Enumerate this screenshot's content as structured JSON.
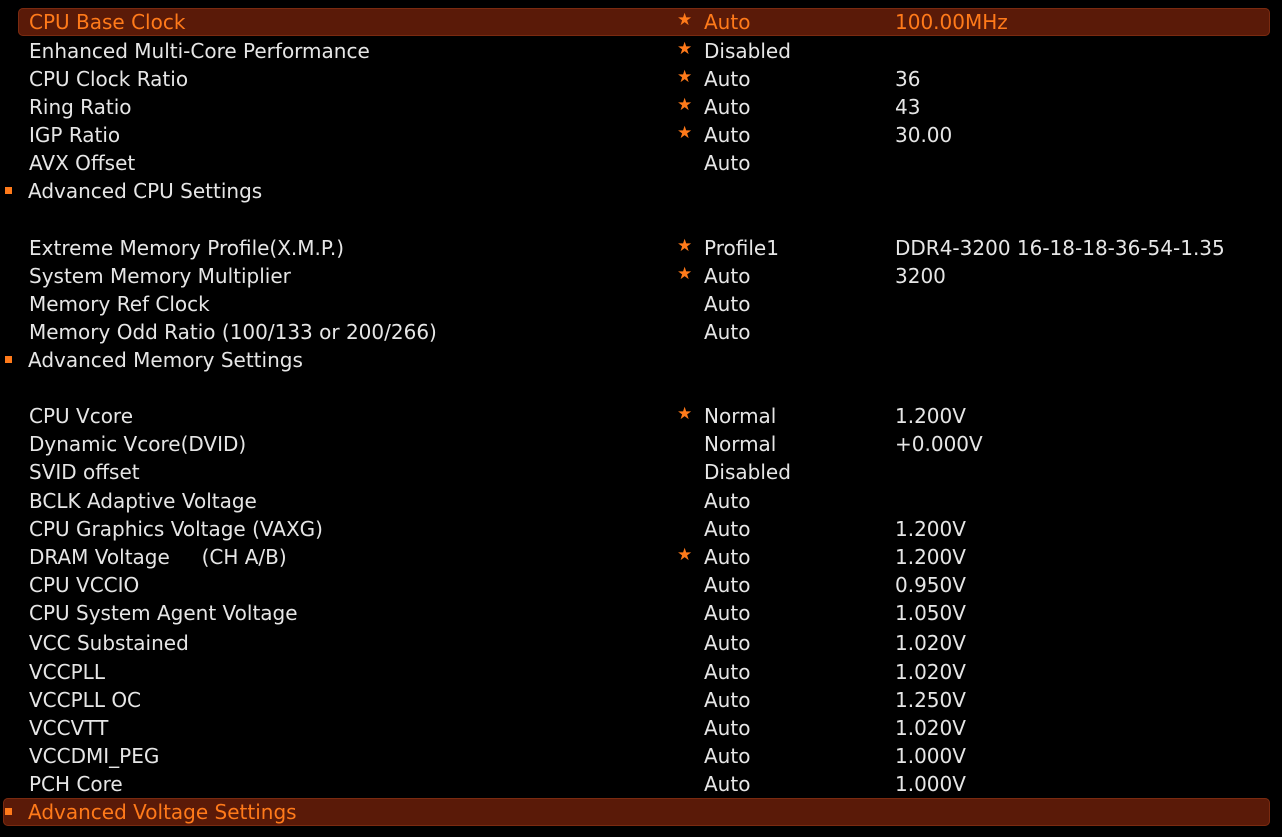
{
  "theme": {
    "accent": "#ff7a1a",
    "highlight_bg": "#5a1a08",
    "text": "#e6e6e6",
    "background": "#000000"
  },
  "rows": [
    {
      "name": "CPU Base Clock",
      "value": "Auto",
      "extra": "100.00MHz",
      "star": "★"
    },
    {
      "name": "Enhanced Multi-Core Performance",
      "value": "Disabled",
      "extra": "",
      "star": "★"
    },
    {
      "name": "CPU Clock Ratio",
      "value": "Auto",
      "extra": "36",
      "star": "★"
    },
    {
      "name": "Ring Ratio",
      "value": "Auto",
      "extra": "43",
      "star": "★"
    },
    {
      "name": "IGP Ratio",
      "value": "Auto",
      "extra": "30.00",
      "star": "★"
    },
    {
      "name": "AVX Offset",
      "value": "Auto",
      "extra": "",
      "star": ""
    },
    {
      "name": "Advanced CPU Settings"
    },
    {
      "name": "Extreme Memory Profile(X.M.P.)",
      "value": "Profile1",
      "extra": "DDR4-3200 16-18-18-36-54-1.35",
      "star": "★"
    },
    {
      "name": "System Memory Multiplier",
      "value": "Auto",
      "extra": "3200",
      "star": "★"
    },
    {
      "name": "Memory Ref Clock",
      "value": "Auto",
      "extra": "",
      "star": ""
    },
    {
      "name": "Memory Odd Ratio (100/133 or 200/266)",
      "value": "Auto",
      "extra": "",
      "star": ""
    },
    {
      "name": "Advanced Memory Settings"
    },
    {
      "name": "CPU Vcore",
      "value": "Normal",
      "extra": "1.200V",
      "star": "★"
    },
    {
      "name": "Dynamic Vcore(DVID)",
      "value": "Normal",
      "extra": "+0.000V",
      "star": ""
    },
    {
      "name": "SVID offset",
      "value": "Disabled",
      "extra": "",
      "star": ""
    },
    {
      "name": "BCLK Adaptive Voltage",
      "value": "Auto",
      "extra": "",
      "star": ""
    },
    {
      "name": "CPU Graphics Voltage (VAXG)",
      "value": "Auto",
      "extra": "1.200V",
      "star": ""
    },
    {
      "name": "DRAM Voltage     (CH A/B)",
      "value": "Auto",
      "extra": "1.200V",
      "star": "★"
    },
    {
      "name": "CPU VCCIO",
      "value": "Auto",
      "extra": "0.950V",
      "star": ""
    },
    {
      "name": "CPU System Agent Voltage",
      "value": "Auto",
      "extra": "1.050V",
      "star": ""
    },
    {
      "name": "VCC Substained",
      "value": "Auto",
      "extra": "1.020V",
      "star": ""
    },
    {
      "name": "VCCPLL",
      "value": "Auto",
      "extra": "1.020V",
      "star": ""
    },
    {
      "name": "VCCPLL OC",
      "value": "Auto",
      "extra": "1.250V",
      "star": ""
    },
    {
      "name": "VCCVTT",
      "value": "Auto",
      "extra": "1.020V",
      "star": ""
    },
    {
      "name": "VCCDMI_PEG",
      "value": "Auto",
      "extra": "1.000V",
      "star": ""
    },
    {
      "name": "PCH Core",
      "value": "Auto",
      "extra": "1.000V",
      "star": ""
    },
    {
      "name": "Advanced Voltage Settings"
    }
  ]
}
